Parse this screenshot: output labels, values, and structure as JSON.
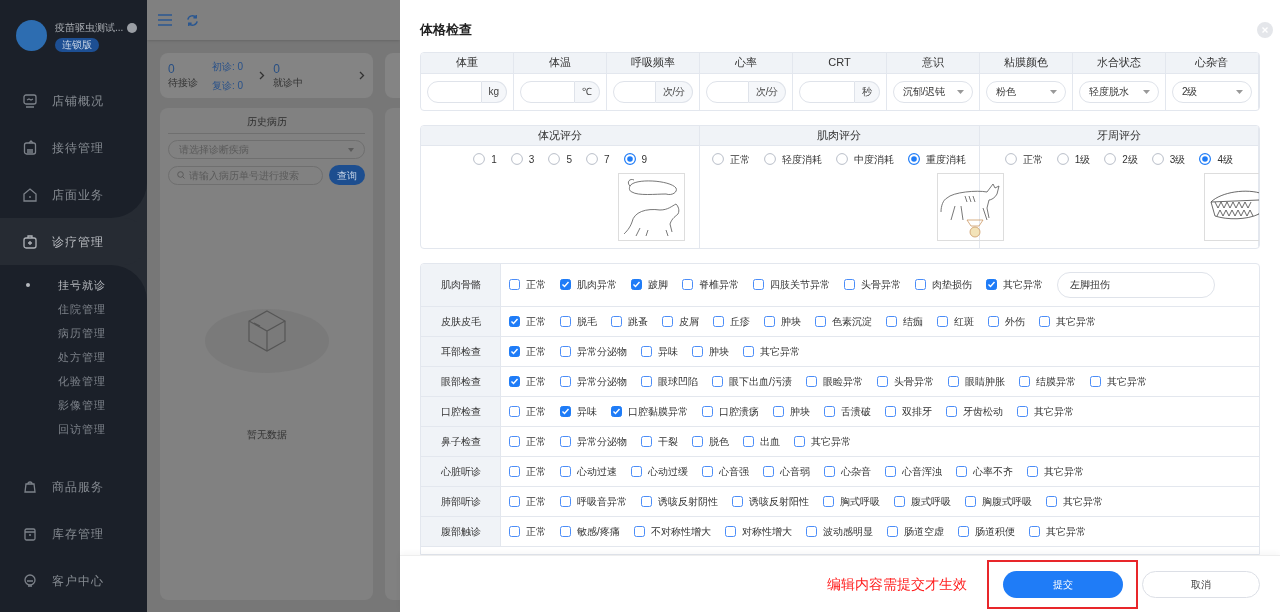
{
  "sidebar": {
    "store_name": "疫苗驱虫测试...",
    "edition_badge": "连锁版",
    "items": [
      {
        "label": "店铺概况",
        "selected": false
      },
      {
        "label": "接待管理",
        "selected": false
      },
      {
        "label": "店面业务",
        "selected": false
      },
      {
        "label": "诊疗管理",
        "selected": true,
        "children": [
          {
            "label": "挂号就诊",
            "selected": true
          },
          {
            "label": "住院管理",
            "selected": false
          },
          {
            "label": "病历管理",
            "selected": false
          },
          {
            "label": "处方管理",
            "selected": false
          },
          {
            "label": "化验管理",
            "selected": false
          },
          {
            "label": "影像管理",
            "selected": false
          },
          {
            "label": "回访管理",
            "selected": false
          }
        ]
      },
      {
        "label": "商品服务",
        "selected": false
      },
      {
        "label": "库存管理",
        "selected": false
      },
      {
        "label": "客户中心",
        "selected": false
      }
    ]
  },
  "stats": [
    {
      "count": "0",
      "label": "待接诊",
      "details": [
        "初诊: 0",
        "复诊: 0"
      ]
    },
    {
      "count": "0",
      "label": "就诊中"
    }
  ],
  "history": {
    "title": "历史病历",
    "diagnosis_select": {
      "placeholder": "请选择诊断疾病"
    },
    "search": {
      "placeholder": "请输入病历单号进行搜索"
    },
    "query_button": "查询",
    "empty_text": "暂无数据"
  },
  "drawer": {
    "title": "体格检查",
    "vitals": [
      {
        "label": "体重",
        "kind": "input",
        "unit": "kg"
      },
      {
        "label": "体温",
        "kind": "input",
        "unit": "℃"
      },
      {
        "label": "呼吸频率",
        "kind": "input",
        "unit": "次/分"
      },
      {
        "label": "心率",
        "kind": "input",
        "unit": "次/分"
      },
      {
        "label": "CRT",
        "kind": "input",
        "unit": "秒"
      },
      {
        "label": "意识",
        "kind": "select",
        "value": "沉郁/迟钝"
      },
      {
        "label": "粘膜颜色",
        "kind": "select",
        "value": "粉色"
      },
      {
        "label": "水合状态",
        "kind": "select",
        "value": "轻度脱水"
      },
      {
        "label": "心杂音",
        "kind": "select",
        "value": "2级"
      }
    ],
    "scores": [
      {
        "title": "体况评分",
        "options": [
          {
            "label": "1",
            "selected": false
          },
          {
            "label": "3",
            "selected": false
          },
          {
            "label": "5",
            "selected": false
          },
          {
            "label": "7",
            "selected": false
          },
          {
            "label": "9",
            "selected": true
          }
        ]
      },
      {
        "title": "肌肉评分",
        "options": [
          {
            "label": "正常",
            "selected": false
          },
          {
            "label": "轻度消耗",
            "selected": false
          },
          {
            "label": "中度消耗",
            "selected": false
          },
          {
            "label": "重度消耗",
            "selected": true
          }
        ]
      },
      {
        "title": "牙周评分",
        "options": [
          {
            "label": "正常",
            "selected": false
          },
          {
            "label": "1级",
            "selected": false
          },
          {
            "label": "2级",
            "selected": false
          },
          {
            "label": "3级",
            "selected": false
          },
          {
            "label": "4级",
            "selected": true
          }
        ]
      }
    ],
    "exams": [
      {
        "label": "肌肉骨骼",
        "note": "左脚扭伤",
        "options": [
          {
            "label": "正常",
            "checked": false
          },
          {
            "label": "肌肉异常",
            "checked": true
          },
          {
            "label": "跛脚",
            "checked": true
          },
          {
            "label": "脊椎异常",
            "checked": false
          },
          {
            "label": "四肢关节异常",
            "checked": false
          },
          {
            "label": "头骨异常",
            "checked": false
          },
          {
            "label": "肉垫损伤",
            "checked": false
          },
          {
            "label": "其它异常",
            "checked": true
          }
        ]
      },
      {
        "label": "皮肤皮毛",
        "options": [
          {
            "label": "正常",
            "checked": true
          },
          {
            "label": "脱毛",
            "checked": false
          },
          {
            "label": "跳蚤",
            "checked": false
          },
          {
            "label": "皮屑",
            "checked": false
          },
          {
            "label": "丘疹",
            "checked": false
          },
          {
            "label": "肿块",
            "checked": false
          },
          {
            "label": "色素沉淀",
            "checked": false
          },
          {
            "label": "结痂",
            "checked": false
          },
          {
            "label": "红斑",
            "checked": false
          },
          {
            "label": "外伤",
            "checked": false
          },
          {
            "label": "其它异常",
            "checked": false
          }
        ]
      },
      {
        "label": "耳部检查",
        "options": [
          {
            "label": "正常",
            "checked": true
          },
          {
            "label": "异常分泌物",
            "checked": false
          },
          {
            "label": "异味",
            "checked": false
          },
          {
            "label": "肿块",
            "checked": false
          },
          {
            "label": "其它异常",
            "checked": false
          }
        ]
      },
      {
        "label": "眼部检查",
        "options": [
          {
            "label": "正常",
            "checked": true
          },
          {
            "label": "异常分泌物",
            "checked": false
          },
          {
            "label": "眼球凹陷",
            "checked": false
          },
          {
            "label": "眼下出血/污渍",
            "checked": false
          },
          {
            "label": "眼睑异常",
            "checked": false
          },
          {
            "label": "头骨异常",
            "checked": false
          },
          {
            "label": "眼睛肿胀",
            "checked": false
          },
          {
            "label": "结膜异常",
            "checked": false
          },
          {
            "label": "其它异常",
            "checked": false
          }
        ]
      },
      {
        "label": "口腔检查",
        "options": [
          {
            "label": "正常",
            "checked": false
          },
          {
            "label": "异味",
            "checked": true
          },
          {
            "label": "口腔黏膜异常",
            "checked": true
          },
          {
            "label": "口腔溃疡",
            "checked": false
          },
          {
            "label": "肿块",
            "checked": false
          },
          {
            "label": "舌溃破",
            "checked": false
          },
          {
            "label": "双排牙",
            "checked": false
          },
          {
            "label": "牙齿松动",
            "checked": false
          },
          {
            "label": "其它异常",
            "checked": false
          }
        ]
      },
      {
        "label": "鼻子检查",
        "options": [
          {
            "label": "正常",
            "checked": false
          },
          {
            "label": "异常分泌物",
            "checked": false
          },
          {
            "label": "干裂",
            "checked": false
          },
          {
            "label": "脱色",
            "checked": false
          },
          {
            "label": "出血",
            "checked": false
          },
          {
            "label": "其它异常",
            "checked": false
          }
        ]
      },
      {
        "label": "心脏听诊",
        "options": [
          {
            "label": "正常",
            "checked": false
          },
          {
            "label": "心动过速",
            "checked": false
          },
          {
            "label": "心动过缓",
            "checked": false
          },
          {
            "label": "心音强",
            "checked": false
          },
          {
            "label": "心音弱",
            "checked": false
          },
          {
            "label": "心杂音",
            "checked": false
          },
          {
            "label": "心音浑浊",
            "checked": false
          },
          {
            "label": "心率不齐",
            "checked": false
          },
          {
            "label": "其它异常",
            "checked": false
          }
        ]
      },
      {
        "label": "肺部听诊",
        "options": [
          {
            "label": "正常",
            "checked": false
          },
          {
            "label": "呼吸音异常",
            "checked": false
          },
          {
            "label": "诱咳反射阴性",
            "checked": false
          },
          {
            "label": "诱咳反射阳性",
            "checked": false
          },
          {
            "label": "胸式呼吸",
            "checked": false
          },
          {
            "label": "腹式呼吸",
            "checked": false
          },
          {
            "label": "胸腹式呼吸",
            "checked": false
          },
          {
            "label": "其它异常",
            "checked": false
          }
        ]
      },
      {
        "label": "腹部触诊",
        "options": [
          {
            "label": "正常",
            "checked": false
          },
          {
            "label": "敏感/疼痛",
            "checked": false
          },
          {
            "label": "不对称性增大",
            "checked": false
          },
          {
            "label": "对称性增大",
            "checked": false
          },
          {
            "label": "波动感明显",
            "checked": false
          },
          {
            "label": "肠道空虚",
            "checked": false
          },
          {
            "label": "肠道积便",
            "checked": false
          },
          {
            "label": "其它异常",
            "checked": false
          }
        ]
      }
    ],
    "footer": {
      "hint": "编辑内容需提交才生效",
      "submit_button": "提交",
      "cancel_button": "取消"
    }
  }
}
